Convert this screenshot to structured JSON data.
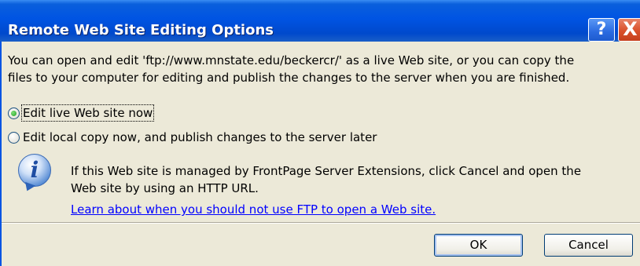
{
  "window": {
    "title": "Remote Web Site Editing Options",
    "help_label": "?",
    "close_label": "X"
  },
  "intro": {
    "line1": "You can open and edit 'ftp://www.mnstate.edu/beckercr/' as a live Web site, or you can copy the",
    "line2": "files to your computer for editing and publish the changes to the server when you are finished."
  },
  "options": [
    {
      "label": "Edit live Web site now",
      "checked": true
    },
    {
      "label": "Edit local copy now, and publish changes to the server later",
      "checked": false
    }
  ],
  "info": {
    "icon": "info-icon",
    "line1": "If this Web site is managed by FrontPage Server Extensions, click Cancel and open the",
    "line2": "Web site by using an HTTP URL.",
    "link": "Learn about when you should not use FTP to open a Web site."
  },
  "buttons": {
    "ok": "OK",
    "cancel": "Cancel"
  },
  "colors": {
    "titlebar": "#0054e3",
    "face": "#ece9d8",
    "link": "#0000ff"
  }
}
